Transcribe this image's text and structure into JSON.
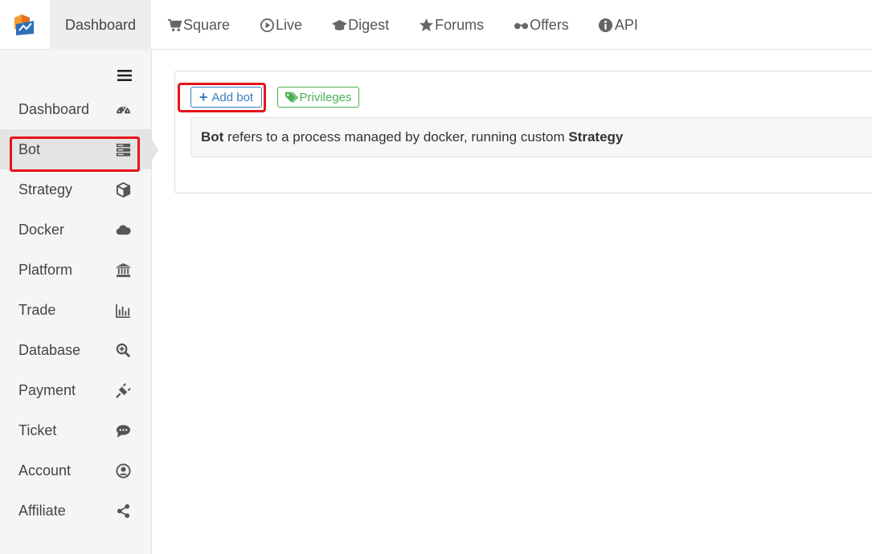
{
  "header": {
    "active_tab": "Dashboard",
    "nav": [
      {
        "label": "Square",
        "icon": "cart-icon"
      },
      {
        "label": "Live",
        "icon": "play-circle-icon"
      },
      {
        "label": "Digest",
        "icon": "graduation-cap-icon"
      },
      {
        "label": "Forums",
        "icon": "star-icon"
      },
      {
        "label": "Offers",
        "icon": "glasses-icon"
      },
      {
        "label": "API",
        "icon": "info-circle-icon"
      }
    ]
  },
  "sidebar": {
    "items": [
      {
        "label": "Dashboard",
        "icon": "dashboard-gauge-icon"
      },
      {
        "label": "Bot",
        "icon": "server-icon"
      },
      {
        "label": "Strategy",
        "icon": "cube-icon"
      },
      {
        "label": "Docker",
        "icon": "cloud-icon"
      },
      {
        "label": "Platform",
        "icon": "bank-icon"
      },
      {
        "label": "Trade",
        "icon": "bar-chart-icon"
      },
      {
        "label": "Database",
        "icon": "search-plus-icon"
      },
      {
        "label": "Payment",
        "icon": "plug-icon"
      },
      {
        "label": "Ticket",
        "icon": "comment-icon"
      },
      {
        "label": "Account",
        "icon": "user-circle-icon"
      },
      {
        "label": "Affiliate",
        "icon": "share-icon"
      }
    ],
    "active_index": 1
  },
  "main": {
    "add_bot_label": "Add bot",
    "privileges_label": "Privileges",
    "info": {
      "bold_1": "Bot",
      "text_1": " refers to a process managed by docker, running custom ",
      "bold_2": "Strategy"
    }
  },
  "colors": {
    "primary": "#3a7dc2",
    "success": "#4caf50",
    "highlight": "#e8141a"
  }
}
